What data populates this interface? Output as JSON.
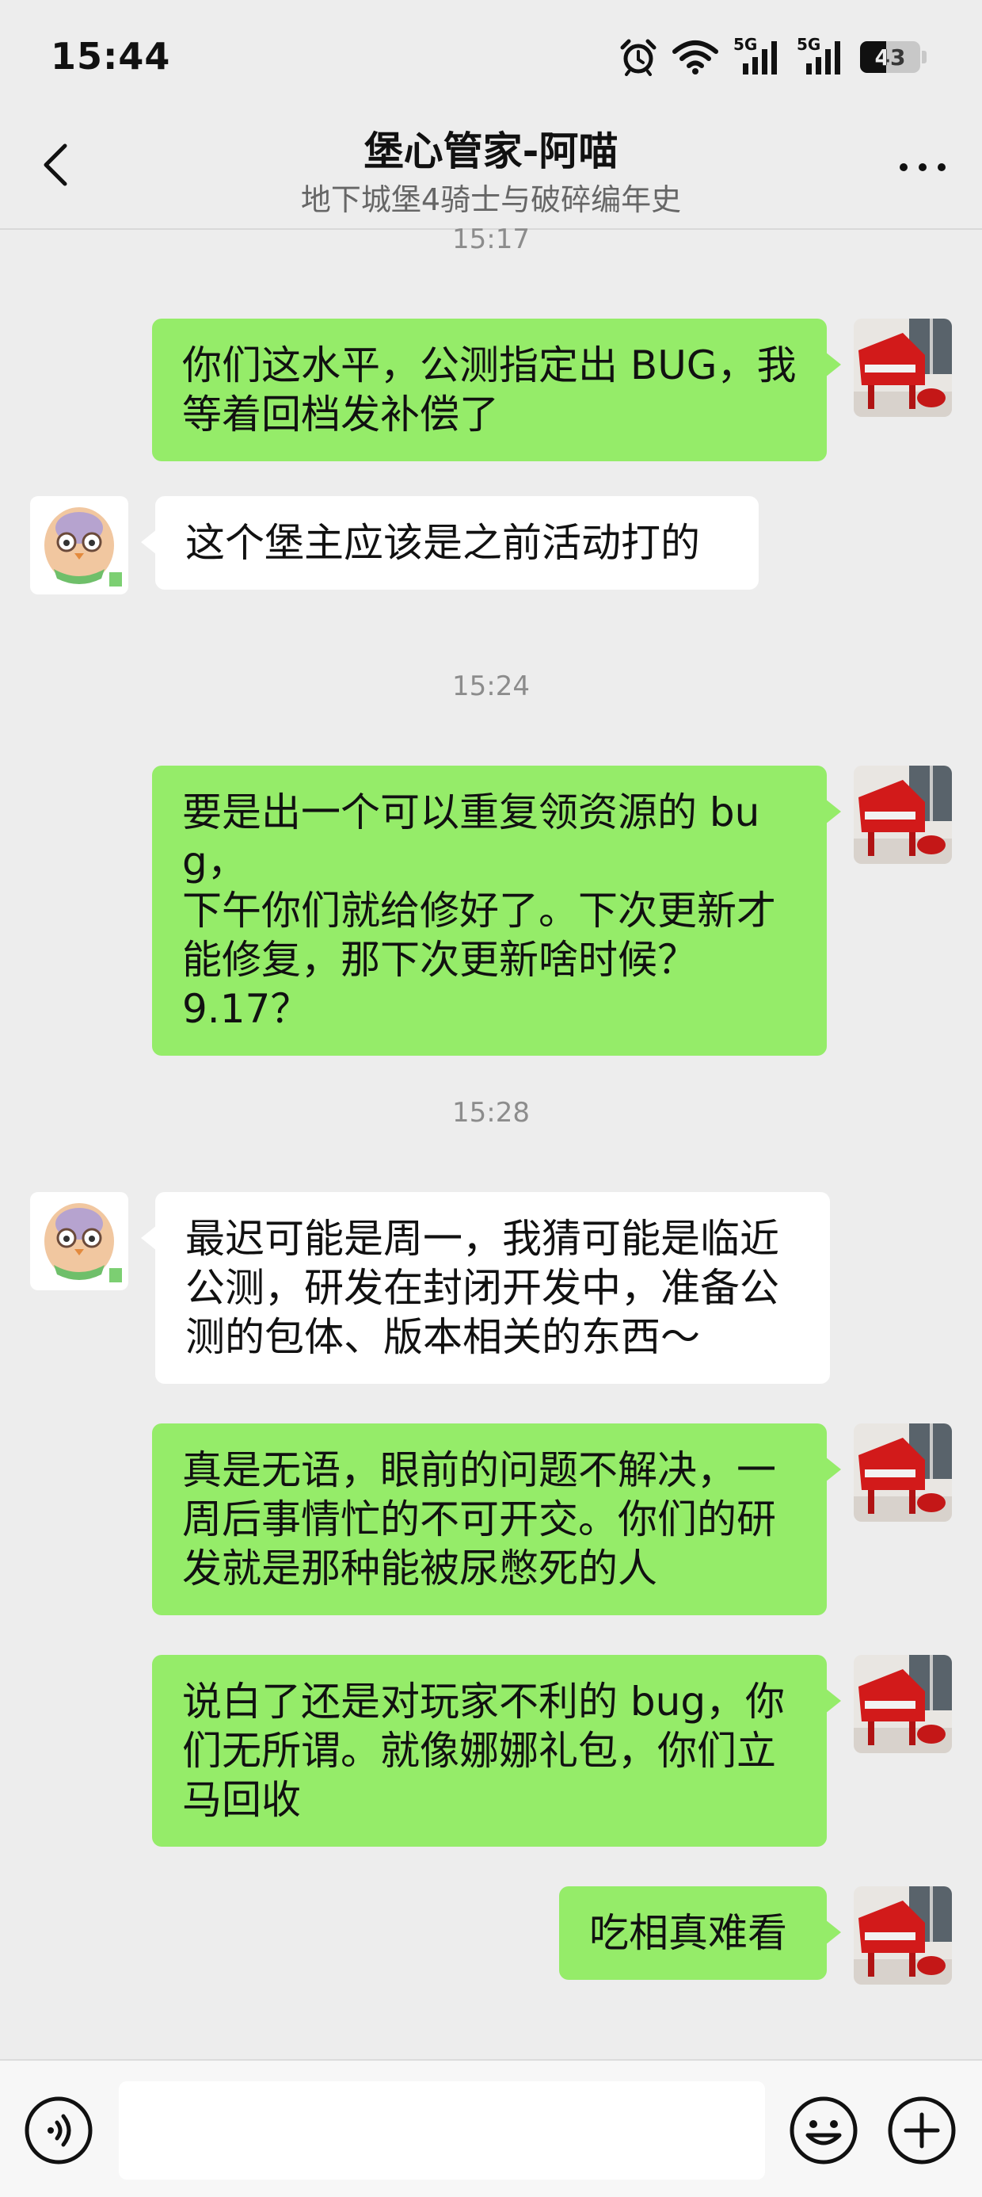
{
  "status_bar": {
    "time": "15:44",
    "signal1_label": "5G",
    "signal2_label": "5G",
    "battery": "43"
  },
  "header": {
    "title": "堡心管家-阿喵",
    "subtitle": "地下城堡4骑士与破碎编年史"
  },
  "messages": {
    "ts1": "15:17",
    "m1": "你们这水平，公测指定出 BUG，我\n等着回档发补偿了",
    "m2": "这个堡主应该是之前活动打的",
    "ts2": "15:24",
    "m3": "要是出一个可以重复领资源的 bug，\n下午你们就给修好了。下次更新才\n能修复，那下次更新啥时候？\n9.17？",
    "ts3": "15:28",
    "m4": "最迟可能是周一，我猜可能是临近\n公测，研发在封闭开发中，准备公\n测的包体、版本相关的东西～",
    "m5": "真是无语，眼前的问题不解决，一\n周后事情忙的不可开交。你们的研\n发就是那种能被尿憋死的人",
    "m6": "说白了还是对玩家不利的 bug，你\n们无所谓。就像娜娜礼包，你们立\n马回收",
    "m7": "吃相真难看"
  },
  "input": {
    "value": "",
    "placeholder": ""
  },
  "icons": {
    "back": "chevron-left-icon",
    "more": "more-dots-icon",
    "voice": "voice-icon",
    "emoji": "emoji-icon",
    "plus": "plus-icon"
  },
  "colors": {
    "sent_bubble": "#95ec69",
    "received_bubble": "#ffffff",
    "background": "#ededed"
  }
}
